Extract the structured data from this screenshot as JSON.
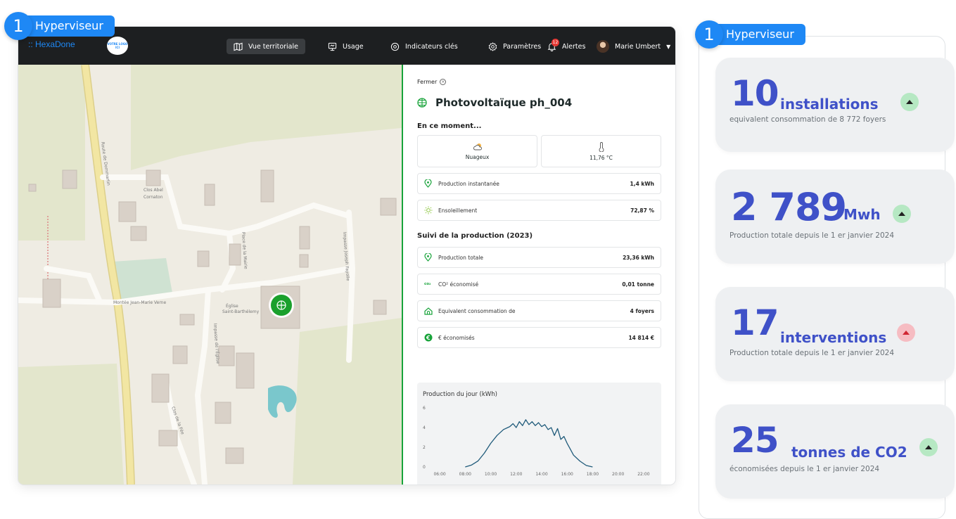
{
  "callouts": [
    {
      "number": "1",
      "label": "Hyperviseur"
    },
    {
      "number": "1",
      "label": "Hyperviseur"
    }
  ],
  "app": {
    "brand": ":: HexaDone",
    "logo_text": "VOTRE LOGO ICI",
    "nav": [
      {
        "label": "Vue territoriale",
        "icon": "map-icon",
        "active": true
      },
      {
        "label": "Usage",
        "icon": "monitor-icon",
        "active": false
      },
      {
        "label": "Indicateurs clés",
        "icon": "eye-icon",
        "active": false
      },
      {
        "label": "Paramètres",
        "icon": "gear-icon",
        "active": false
      },
      {
        "label": "Alertes",
        "icon": "bell-icon",
        "active": false,
        "badge": "12"
      }
    ],
    "user": {
      "name": "Marie Umbert"
    }
  },
  "map": {
    "labels": {
      "clos_abel": "Clos Abel",
      "cornaton": "Cornaton",
      "route": "Route de Dommartin",
      "montee": "Montée Jean-Marie Verne",
      "eglise": "Église",
      "saint_barthelemy": "Saint-Barthélemy",
      "impasse_jf": "Impasse Joseph Fayolle",
      "impasse_eglise": "Impasse de l'Église",
      "place_mairie": "Place de la Mairie",
      "clos_fee": "Clos de la Fée"
    },
    "marker_icon": "solar-panel-icon"
  },
  "panel": {
    "close_label": "Fermer",
    "title": "Photovoltaïque ph_004",
    "now_title": "En ce moment...",
    "weather": {
      "label": "Nuageux",
      "icon": "cloud-icon"
    },
    "temperature": {
      "value": "11,76 °C",
      "icon": "thermometer-icon"
    },
    "now_rows": [
      {
        "label": "Production instantanée",
        "value": "1,4 kWh",
        "icon": "location-pin-icon"
      },
      {
        "label": "Ensoleillement",
        "value": "72,87 %",
        "icon": "sun-icon"
      }
    ],
    "tracking_title": "Suivi de la production (2023)",
    "tracking_rows": [
      {
        "label": "Production totale",
        "value": "23,36 kWh",
        "icon": "location-pin-icon"
      },
      {
        "label": "CO² économisé",
        "value": "0,01 tonne",
        "icon": "co2-icon"
      },
      {
        "label": "Equivalent consommation de",
        "value": "4 foyers",
        "icon": "house-icon"
      },
      {
        "label": "€ économisés",
        "value": "14 814 €",
        "icon": "euro-icon"
      }
    ]
  },
  "chart_data": {
    "type": "line",
    "title": "Production du jour (kWh)",
    "xlabel": "",
    "ylabel": "",
    "ylim": [
      0,
      6
    ],
    "yticks": [
      0,
      2,
      4,
      6
    ],
    "xticks": [
      "06:00",
      "08:00",
      "10:00",
      "12:00",
      "14:00",
      "16:00",
      "18:00",
      "20:00",
      "22:00"
    ],
    "xlim": [
      5,
      23
    ],
    "color": "#1f5a7a",
    "grid": false,
    "series": [
      {
        "x": [
          8,
          8.5,
          9,
          9.5,
          10,
          10.5,
          11,
          11.5,
          11.75,
          12,
          12.25,
          12.5,
          12.75,
          13,
          13.25,
          13.5,
          13.75,
          14,
          14.25,
          14.5,
          14.75,
          15,
          15.25,
          15.5,
          15.75,
          16,
          16.25,
          16.5,
          17,
          17.5,
          18
        ],
        "y": [
          0,
          0.2,
          0.6,
          1.4,
          2.4,
          3.2,
          3.8,
          4.1,
          4.4,
          4.0,
          4.6,
          4.2,
          4.8,
          4.3,
          4.6,
          4.2,
          4.5,
          4.1,
          4.3,
          3.8,
          4.0,
          3.2,
          3.9,
          2.8,
          3.1,
          2.4,
          1.8,
          1.2,
          0.6,
          0.15,
          0
        ]
      }
    ]
  },
  "kpis": [
    {
      "value": "10",
      "unit": "installations",
      "sub": "equivalent consommation de 8 772 foyers",
      "trend": "up"
    },
    {
      "value": "2 789",
      "unit": "Mwh",
      "sub": "Production totale depuis le 1 er janvier 2024",
      "trend": "up"
    },
    {
      "value": "17",
      "unit": "interventions",
      "sub": "Production totale depuis le 1 er janvier 2024",
      "trend": "down"
    },
    {
      "value": "25",
      "unit": "tonnes de CO2",
      "sub": "économisées depuis le 1 er janvier 2024",
      "trend": "up"
    }
  ],
  "colors": {
    "accent_blue": "#1e88f5",
    "kpi_blue": "#3f51c8",
    "green_divider": "#18a33a",
    "topbar": "#1d1f21"
  }
}
